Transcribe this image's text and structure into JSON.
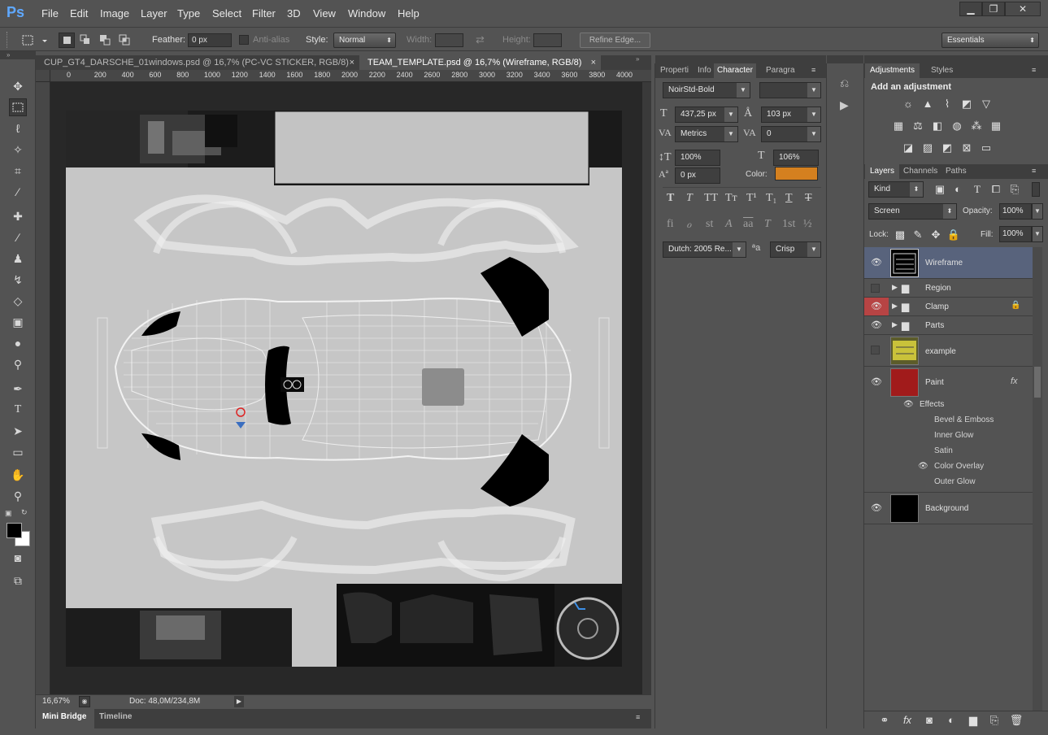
{
  "app": {
    "logo": "Ps"
  },
  "menu": [
    "File",
    "Edit",
    "Image",
    "Layer",
    "Type",
    "Select",
    "Filter",
    "3D",
    "View",
    "Window",
    "Help"
  ],
  "window_controls": {
    "minimize": "▁",
    "restore": "❐",
    "close": "✕"
  },
  "options_bar": {
    "feather_label": "Feather:",
    "feather_value": "0 px",
    "antialias_label": "Anti-alias",
    "style_label": "Style:",
    "style_value": "Normal",
    "width_label": "Width:",
    "height_label": "Height:",
    "refine_edge": "Refine Edge...",
    "workspace": "Essentials"
  },
  "doc_tabs": [
    {
      "label": "CUP_GT4_DARSCHE_01windows.psd @ 16,7% (PC-VC STICKER, RGB/8)",
      "close": "×",
      "active": false
    },
    {
      "label": "TEAM_TEMPLATE.psd @ 16,7% (Wireframe, RGB/8)",
      "close": "×",
      "active": true
    }
  ],
  "ruler_ticks": [
    "0",
    "200",
    "400",
    "600",
    "800",
    "1000",
    "1200",
    "1400",
    "1600",
    "1800",
    "2000",
    "2200",
    "2400",
    "2600",
    "2800",
    "3000",
    "3200",
    "3400",
    "3600",
    "3800",
    "4000"
  ],
  "status": {
    "zoom": "16,67%",
    "doc": "Doc: 48,0M/234,8M"
  },
  "bottom_tabs": {
    "mini_bridge": "Mini Bridge",
    "timeline": "Timeline"
  },
  "char_panel": {
    "tabs": [
      "Properti",
      "Info",
      "Character",
      "Paragra"
    ],
    "font_family": "NoirStd-Bold",
    "font_style": "",
    "font_size": "437,25 px",
    "leading": "103 px",
    "kerning": "Metrics",
    "tracking": "0",
    "vscale": "100%",
    "hscale": "106%",
    "baseline": "0 px",
    "color_label": "Color:",
    "color": "#d4801f",
    "style_buttons": [
      "T",
      "T",
      "TT",
      "Tт",
      "T¹",
      "T₁",
      "T",
      "T"
    ],
    "ot_buttons": [
      "fi",
      "ℴ",
      "st",
      "A",
      "aa",
      "T",
      "1st",
      "½"
    ],
    "language": "Dutch: 2005 Re...",
    "aa_label": "ªa",
    "antialias": "Crisp"
  },
  "adjustments": {
    "tabs": [
      "Adjustments",
      "Styles"
    ],
    "heading": "Add an adjustment"
  },
  "layers_panel": {
    "tabs": [
      "Layers",
      "Channels",
      "Paths"
    ],
    "kind": "Kind",
    "blend_mode": "Screen",
    "opacity_label": "Opacity:",
    "opacity": "100%",
    "lock_label": "Lock:",
    "fill_label": "Fill:",
    "fill": "100%",
    "layers": [
      {
        "name": "Wireframe",
        "visible": true,
        "type": "layer"
      },
      {
        "name": "Region",
        "visible": false,
        "type": "group"
      },
      {
        "name": "Clamp",
        "visible": true,
        "type": "group",
        "locked": true
      },
      {
        "name": "Parts",
        "visible": true,
        "type": "group"
      },
      {
        "name": "example",
        "visible": false,
        "type": "layer"
      },
      {
        "name": "Paint",
        "visible": true,
        "type": "layer",
        "fx": "fx"
      },
      {
        "name": "Background",
        "visible": true,
        "type": "layer"
      }
    ],
    "effects_label": "Effects",
    "effects": [
      "Bevel & Emboss",
      "Inner Glow",
      "Satin",
      "Color Overlay",
      "Outer Glow"
    ]
  }
}
